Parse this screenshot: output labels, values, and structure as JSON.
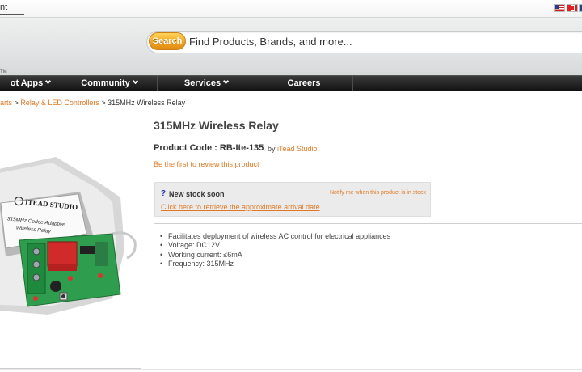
{
  "top": {
    "account_link": "nt"
  },
  "header": {
    "logo_tm": "TM",
    "search_button": "Search",
    "search_placeholder": "Find Products, Brands, and more..."
  },
  "nav": {
    "items": [
      {
        "label": "ot Apps",
        "dropdown": true
      },
      {
        "label": "Community",
        "dropdown": true
      },
      {
        "label": "Services",
        "dropdown": true
      },
      {
        "label": "Careers",
        "dropdown": false
      }
    ]
  },
  "breadcrumb": {
    "items": [
      "arts",
      "Relay & LED Controllers"
    ],
    "separator": ">",
    "current": "315MHz Wireless Relay"
  },
  "product": {
    "title": "315MHz Wireless Relay",
    "code": "Product Code : RB-Ite-135",
    "by_prefix": "by",
    "brand": "iTead Studio",
    "review_link": "Be the first to review this product",
    "image_label": {
      "brand": "ITEAD STUDIO",
      "line1": "315MHz Codec-Adaptive",
      "line2": "Wireless Relay"
    },
    "stock": {
      "icon": "question-icon",
      "title": "New stock soon",
      "notify": "Notify me when this product is in stock",
      "arrival_link": "Click here to retrieve the approximate arrival date"
    },
    "features": [
      "Facilitates deployment of wireless AC control for electrical appliances",
      "Voltage: DC12V",
      "Working current: ≤6mA",
      "Frequency: 315MHz"
    ]
  },
  "colors": {
    "accent_orange": "#e07a28",
    "nav_bg": "#1a1a1a",
    "search_button": "#f0a020"
  }
}
